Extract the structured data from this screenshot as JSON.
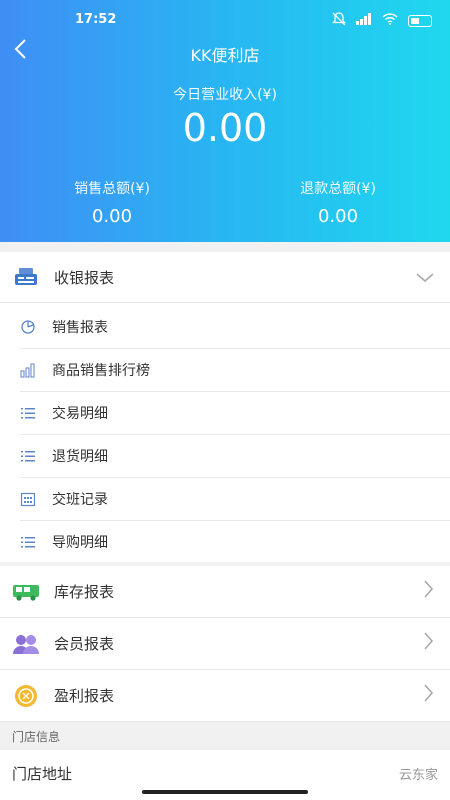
{
  "status": {
    "time": "17:52"
  },
  "header": {
    "title": "KK便利店",
    "income_label": "今日营业收入(¥)",
    "income_value": "0.00",
    "sales_label": "销售总额(¥)",
    "sales_value": "0.00",
    "refund_label": "退款总额(¥)",
    "refund_value": "0.00"
  },
  "cashier": {
    "label": "收银报表",
    "items": [
      {
        "label": "销售报表",
        "icon": "pie-icon"
      },
      {
        "label": "商品销售排行榜",
        "icon": "bar-chart-icon"
      },
      {
        "label": "交易明细",
        "icon": "list-icon"
      },
      {
        "label": "退货明细",
        "icon": "list-icon"
      },
      {
        "label": "交班记录",
        "icon": "calendar-icon"
      },
      {
        "label": "导购明细",
        "icon": "list-icon"
      }
    ]
  },
  "reports": [
    {
      "label": "库存报表",
      "icon": "truck-icon",
      "color": "#3dbb5c"
    },
    {
      "label": "会员报表",
      "icon": "members-icon",
      "color": "#8a70d6"
    },
    {
      "label": "盈利报表",
      "icon": "coin-icon",
      "color": "#f5b82e"
    }
  ],
  "store": {
    "section_label": "门店信息",
    "address_label": "门店地址",
    "address_value": "云东家"
  }
}
